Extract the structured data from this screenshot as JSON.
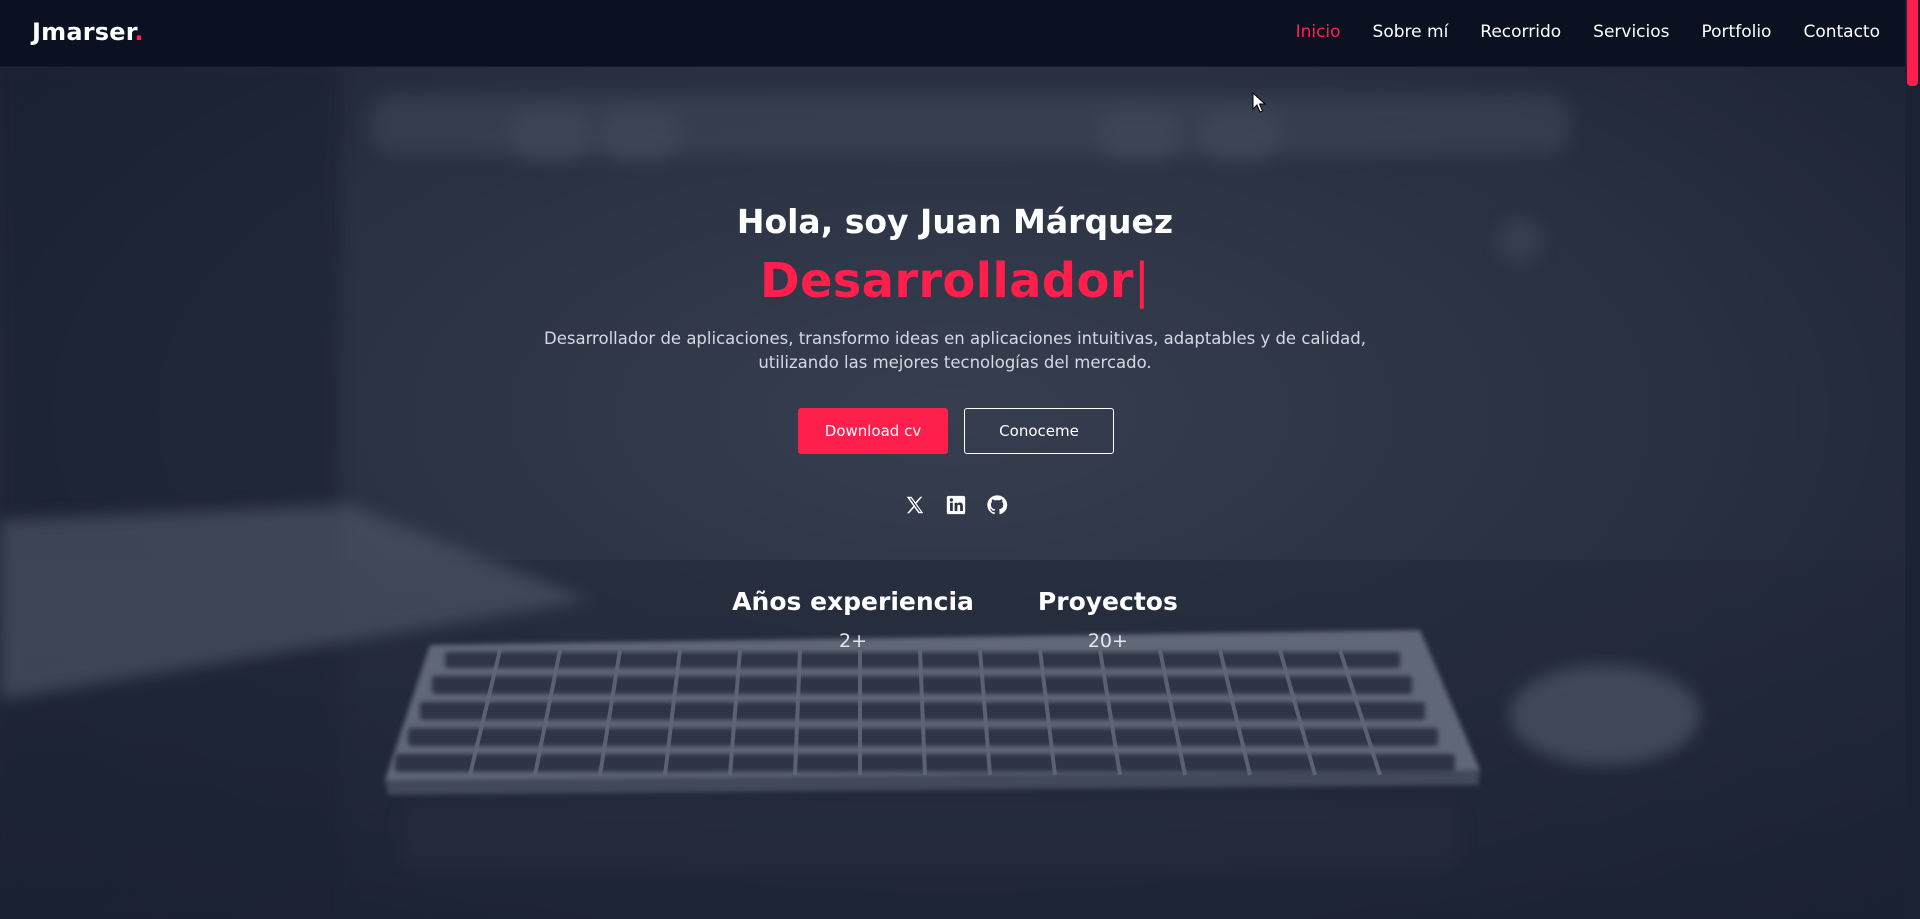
{
  "nav": {
    "logo_text": "Jmarser",
    "logo_dot": ".",
    "items": [
      {
        "label": "Inicio",
        "active": true
      },
      {
        "label": "Sobre mí",
        "active": false
      },
      {
        "label": "Recorrido",
        "active": false
      },
      {
        "label": "Servicios",
        "active": false
      },
      {
        "label": "Portfolio",
        "active": false
      },
      {
        "label": "Contacto",
        "active": false
      }
    ]
  },
  "hero": {
    "greeting": "Hola, soy Juan Márquez",
    "role": "Desarrollador",
    "cursor": "|",
    "description": "Desarrollador de aplicaciones, transformo ideas en aplicaciones intuitivas, adaptables y de calidad, utilizando las mejores tecnologías del mercado.",
    "download_button": "Download cv",
    "about_button": "Conoceme",
    "socials": [
      {
        "icon": "x-twitter-icon"
      },
      {
        "icon": "linkedin-icon"
      },
      {
        "icon": "github-icon"
      }
    ],
    "stats": [
      {
        "label": "Años experiencia",
        "value": "2+"
      },
      {
        "label": "Proyectos",
        "value": "20+"
      }
    ]
  },
  "colors": {
    "accent": "#ff1f4d",
    "nav_background": "#0b1120",
    "text": "#ffffff"
  }
}
